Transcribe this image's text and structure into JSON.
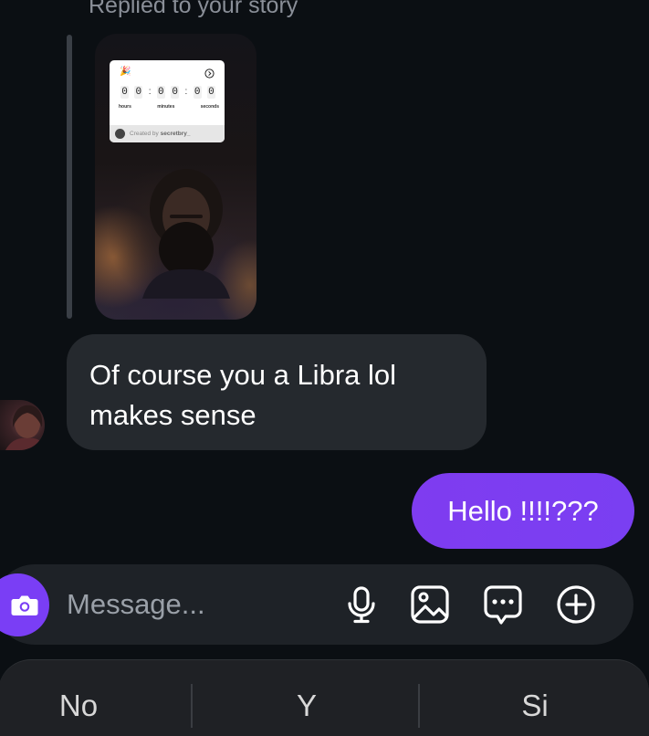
{
  "thread": {
    "reply_label": "Replied to your story",
    "story": {
      "countdown": {
        "digits": [
          "0",
          "0",
          "0",
          "0",
          "0",
          "0"
        ],
        "units": [
          "hours",
          "minutes",
          "seconds"
        ],
        "created_by_prefix": "Created by",
        "created_by_user": "secretbry_"
      }
    },
    "incoming_message": {
      "line1": "Of course you a Libra lol",
      "line2": "makes sense"
    },
    "outgoing_message": {
      "text": "Hello !!!!???"
    }
  },
  "composer": {
    "placeholder": "Message...",
    "value": "",
    "icons": [
      "camera-icon",
      "microphone-icon",
      "gallery-icon",
      "sticker-chat-icon",
      "plus-circle-icon"
    ]
  },
  "keyboard": {
    "suggestions": [
      "No",
      "Y",
      "Si"
    ]
  },
  "colors": {
    "background": "#0b0f13",
    "incoming_bubble": "#25292e",
    "outgoing_bubble": "#7f3cf0",
    "accent": "#7a3ef5"
  }
}
